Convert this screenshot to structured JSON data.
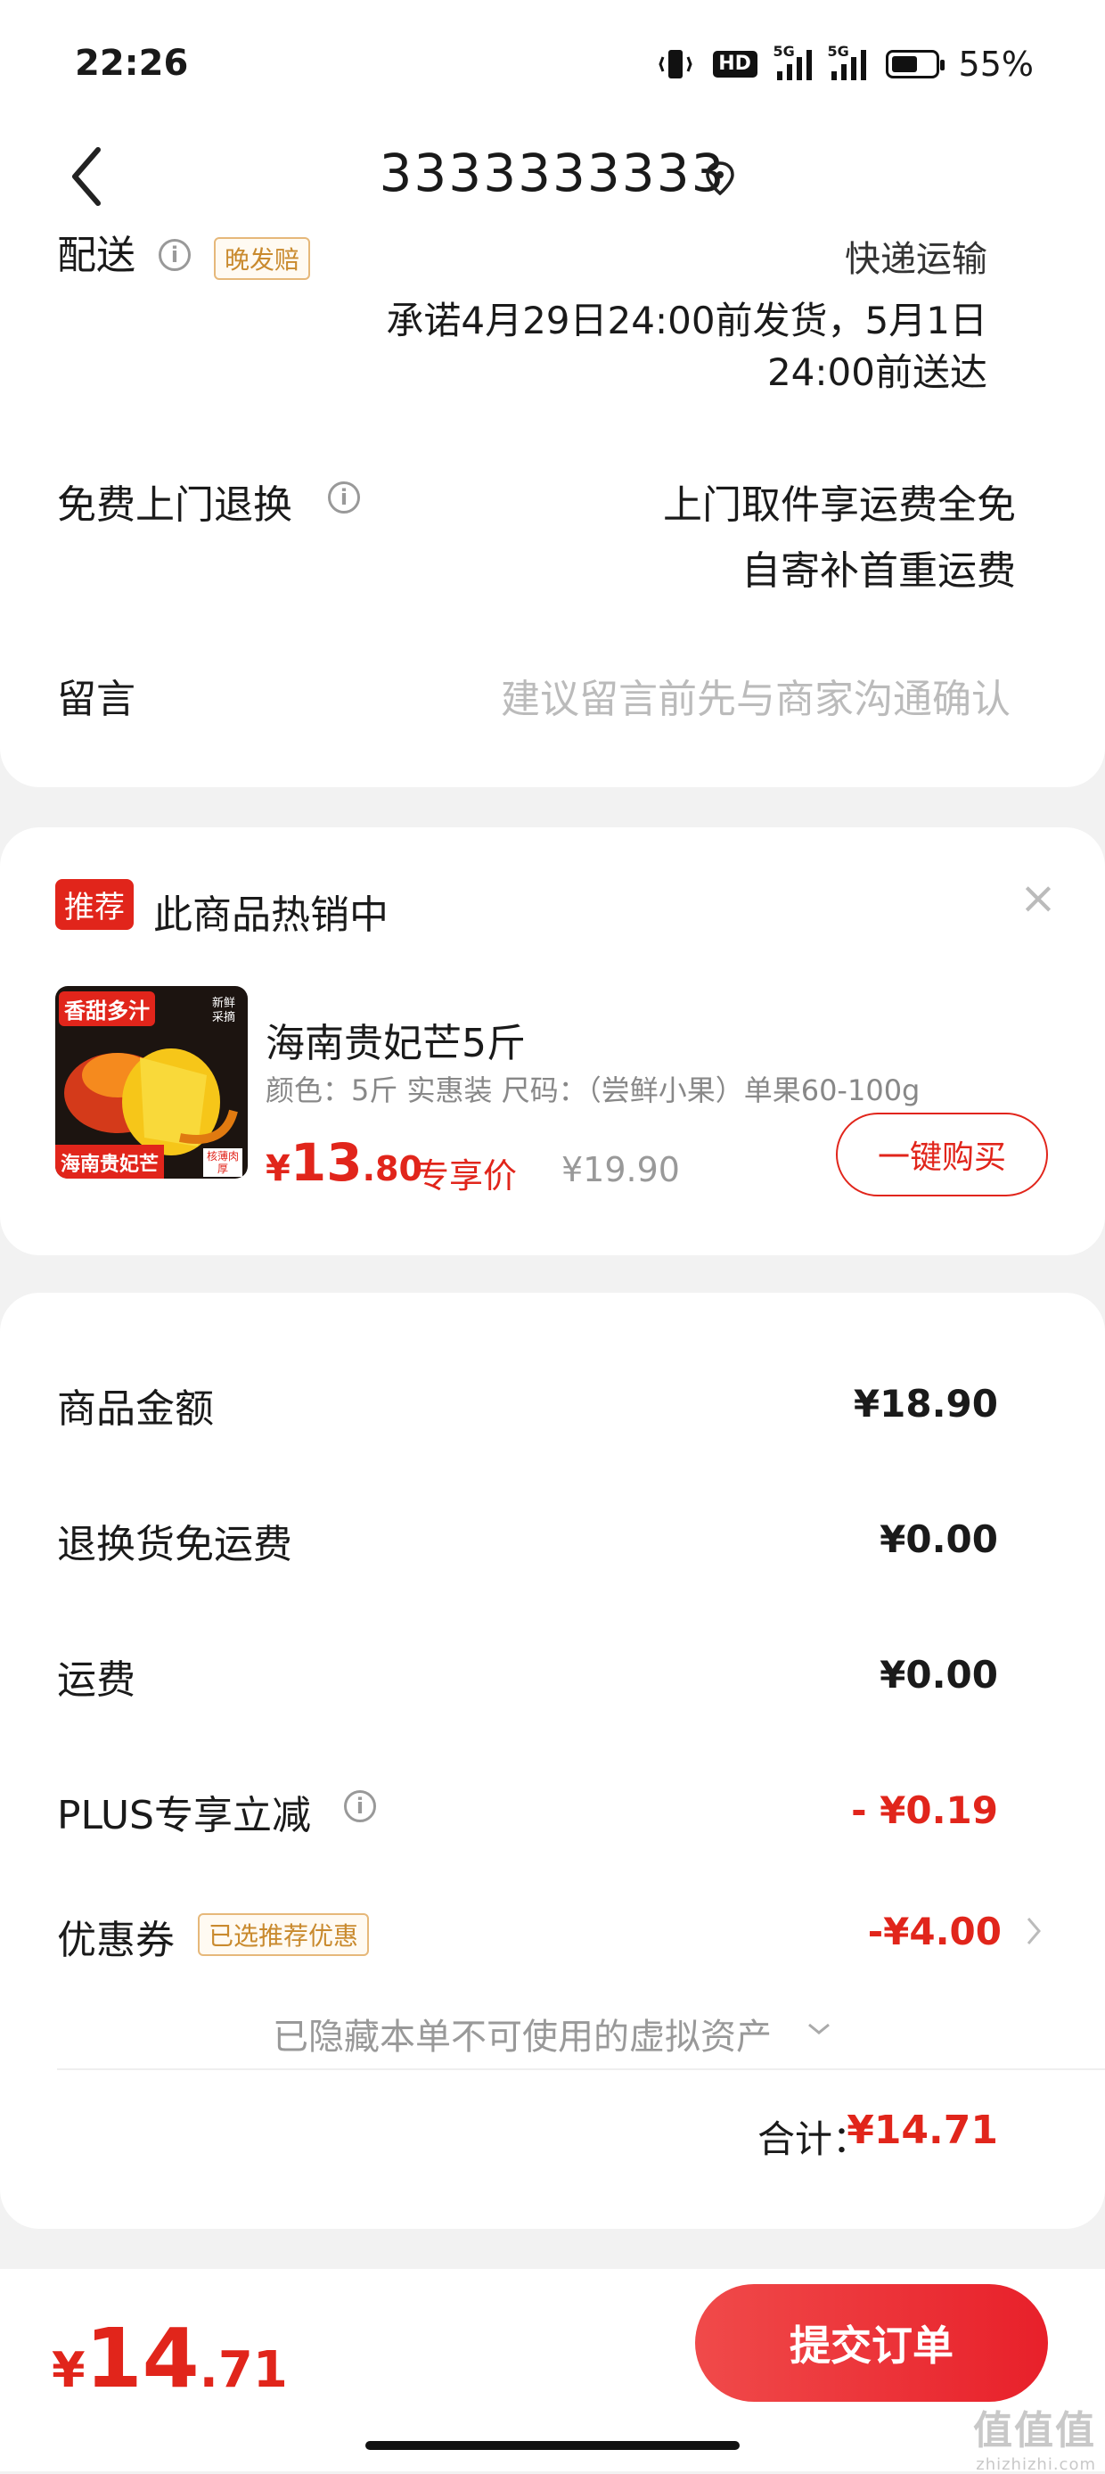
{
  "status_bar": {
    "time": "22:26",
    "hd_label": "HD",
    "net1": "5G",
    "net2": "5G",
    "battery_pct": "55%"
  },
  "header": {
    "title": "3333333333"
  },
  "delivery": {
    "label": "配送",
    "late_tag": "晚发赔",
    "method": "快递运输",
    "promise_line1": "承诺4月29日24:00前发货，5月1日",
    "promise_line2": "24:00前送达"
  },
  "free_return": {
    "label": "免费上门退换",
    "line1": "上门取件享运费全免",
    "line2": "自寄补首重运费"
  },
  "message": {
    "label": "留言",
    "placeholder": "建议留言前先与商家沟通确认"
  },
  "recommend": {
    "badge": "推荐",
    "title": "此商品热销中",
    "close": "×",
    "product": {
      "img_top_text": "香甜多汁",
      "img_corner_text": "新鲜采摘",
      "img_bottom_text": "海南贵妃芒",
      "img_badge_text": "核薄肉厚",
      "name": "海南贵妃芒5斤",
      "spec": "颜色：5斤 实惠装   尺码：（尝鲜小果）单果60-100g",
      "currency": "¥",
      "price_int": "13",
      "price_dec": ".80",
      "price_tag": "专享价",
      "orig_price": "¥19.90",
      "buy_button": "一键购买"
    }
  },
  "summary": {
    "goods_amount_label": "商品金额",
    "goods_amount": "¥18.90",
    "return_free_label": "退换货免运费",
    "return_free": "¥0.00",
    "shipping_label": "运费",
    "shipping": "¥0.00",
    "plus_label": "PLUS专享立减",
    "plus_value": "- ¥0.19",
    "coupon_label": "优惠券",
    "coupon_tag": "已选推荐优惠",
    "coupon_value": "-¥4.00",
    "hidden_assets": "已隐藏本单不可使用的虚拟资产",
    "total_label": "合计：",
    "total_value": "¥14.71"
  },
  "bottom": {
    "currency": "¥",
    "price_int": "14",
    "price_dec": ".71",
    "submit": "提交订单"
  },
  "watermark": {
    "main": "值值值",
    "sub": "zhizhizhi.com"
  }
}
